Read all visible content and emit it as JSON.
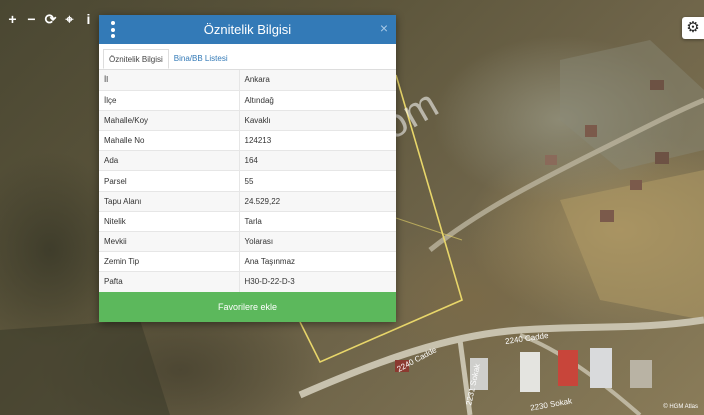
{
  "map": {
    "tools": [
      {
        "name": "zoom-in-icon",
        "glyph": "+"
      },
      {
        "name": "zoom-out-icon",
        "glyph": "−"
      },
      {
        "name": "refresh-icon",
        "glyph": "⟳"
      },
      {
        "name": "locate-icon",
        "glyph": "⌖"
      },
      {
        "name": "info-icon",
        "glyph": "i"
      }
    ],
    "settings_icon": "⚙",
    "watermark": "emlakjet.com",
    "streets": [
      "2240 Cadde",
      "2240 Cadde",
      "2231 Sokak",
      "2230 Sokak"
    ],
    "attribution": "© HGM Atlas"
  },
  "panel": {
    "title": "Öznitelik Bilgisi",
    "close": "×",
    "tabs": [
      "Öznitelik Bilgisi",
      "Bina/BB Listesi"
    ],
    "rows": [
      {
        "key": "İl",
        "value": "Ankara"
      },
      {
        "key": "İlçe",
        "value": "Altındağ"
      },
      {
        "key": "Mahalle/Koy",
        "value": "Kavaklı"
      },
      {
        "key": "Mahalle No",
        "value": "124213"
      },
      {
        "key": "Ada",
        "value": "164"
      },
      {
        "key": "Parsel",
        "value": "55"
      },
      {
        "key": "Tapu Alanı",
        "value": "24.529,22"
      },
      {
        "key": "Nitelik",
        "value": "Tarla"
      },
      {
        "key": "Mevkii",
        "value": "Yolarası"
      },
      {
        "key": "Zemin Tip",
        "value": "Ana Taşınmaz"
      },
      {
        "key": "Pafta",
        "value": "H30-D-22-D-3"
      }
    ],
    "favorite_button": "Favorilere ekle"
  },
  "colors": {
    "header": "#337ab7",
    "favorite": "#5cb85c",
    "parcel_outline": "#e8d66a"
  }
}
